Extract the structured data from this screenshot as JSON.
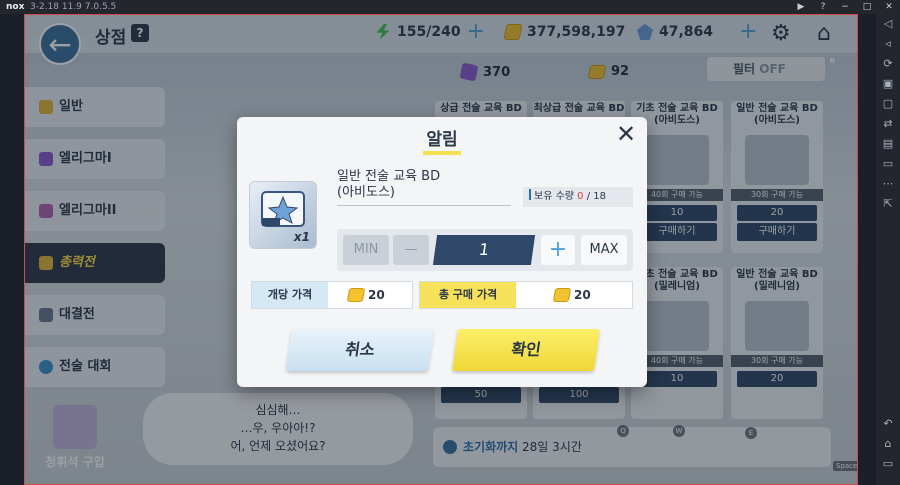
{
  "emulator": {
    "logo": "nox",
    "version": "3-2.18 11.9 7.0.5.5",
    "controls": [
      "▶",
      "?",
      "−",
      "□",
      "✕"
    ],
    "sidebar_icons": [
      "volume-up-icon",
      "volume-down-icon",
      "rotate-icon",
      "screenshot-icon",
      "record-icon",
      "sync-icon",
      "toolbox-icon",
      "keyboard-icon",
      "more-icon",
      "fullscreen-icon",
      "back-icon",
      "home-icon",
      "recent-apps-icon"
    ]
  },
  "header": {
    "title": "상점",
    "help": "?",
    "ap": "155/240",
    "credits": "377,598,197",
    "gems": "47,864"
  },
  "currencies2": {
    "purple_count": "370",
    "coin_count": "92"
  },
  "filter": {
    "label": "필터",
    "state": "OFF",
    "key": "R"
  },
  "tabs": [
    {
      "label": "일반",
      "color": "#e0b43c"
    },
    {
      "label": "엘리그마I",
      "color": "#8a5ad0"
    },
    {
      "label": "엘리그마II",
      "color": "#b060b0"
    },
    {
      "label": "총력전",
      "color": "#e0b43c"
    },
    {
      "label": "대결전",
      "color": "#6a7890"
    },
    {
      "label": "전술 대회",
      "color": "#3a8fc8"
    }
  ],
  "cards": [
    {
      "title": "상급 전술 교육 BD",
      "limit": "",
      "price": "",
      "buy": ""
    },
    {
      "title": "최상급 전술 교육 BD",
      "limit": "",
      "price": "",
      "buy": ""
    },
    {
      "title": "기초 전술 교육 BD (아비도스)",
      "limit": "40회 구매 가능",
      "price": "10",
      "buy": "구매하기"
    },
    {
      "title": "일반 전술 교육 BD (아비도스)",
      "limit": "30회 구매 가능",
      "price": "20",
      "buy": "구매하기"
    },
    {
      "title": "",
      "limit": "",
      "price": "50",
      "buy": ""
    },
    {
      "title": "",
      "limit": "",
      "price": "100",
      "buy": ""
    },
    {
      "title": "기초 전술 교육 BD (밀레니엄)",
      "limit": "40회 구매 가능",
      "price": "10",
      "buy": ""
    },
    {
      "title": "일반 전술 교육 BD (밀레니엄)",
      "limit": "30회 구매 가능",
      "price": "20",
      "buy": ""
    }
  ],
  "card_qty": "x1",
  "speech": {
    "line1": "심심해…",
    "line2": "…우, 우아아!?",
    "line3": "어, 언제 오셨어요?"
  },
  "gacha_label": "청휘석 구입",
  "reset": {
    "prefix": "초기화까지",
    "time": "28일 3시간"
  },
  "keys": {
    "q": "Q",
    "w": "W",
    "e": "E",
    "space": "Space"
  },
  "modal": {
    "title": "알림",
    "item_name_line1": "일반 전술 교육 BD",
    "item_name_line2": "(아비도스)",
    "item_qty": "x1",
    "owned_label": "보유 수량",
    "owned_current": "0",
    "owned_max": "/ 18",
    "min_label": "MIN",
    "minus_label": "—",
    "quantity": "1",
    "plus_label": "+",
    "max_label": "MAX",
    "unit_price_label": "개당 가격",
    "unit_price": "20",
    "total_price_label": "총 구매 가격",
    "total_price": "20",
    "cancel_label": "취소",
    "confirm_label": "확인"
  },
  "colors": {
    "accent_yellow": "#f6e25a",
    "navy": "#2f4768",
    "owned_red": "#d8413c",
    "plus_blue": "#4aa0d8"
  }
}
